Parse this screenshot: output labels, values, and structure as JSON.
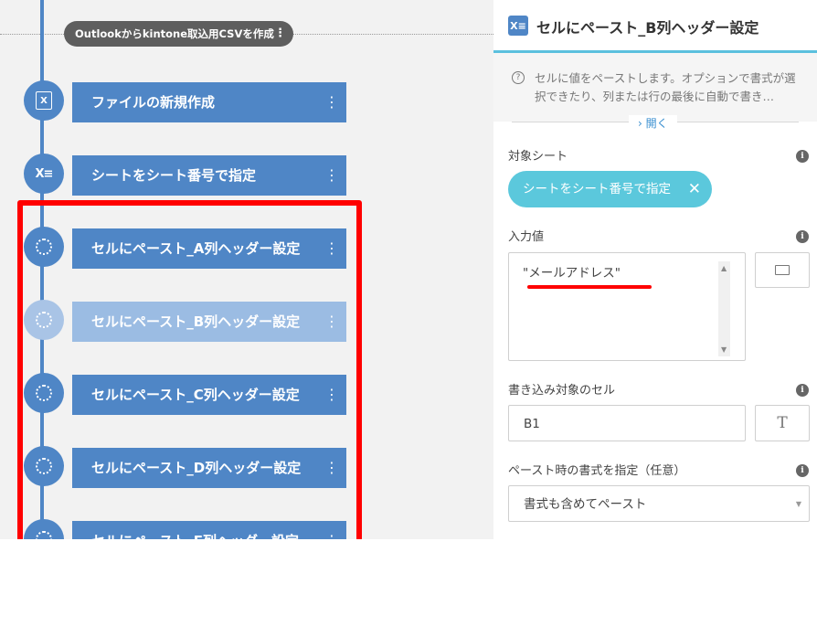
{
  "flow": {
    "group_label": "Outlookからkintone取込用CSVを作成",
    "steps": [
      {
        "label": "ファイルの新規作成",
        "icon": "excel-icon",
        "faded": false
      },
      {
        "label": "シートをシート番号で指定",
        "icon": "excel-sheet-icon",
        "faded": false
      },
      {
        "label": "セルにペースト_A列ヘッダー設定",
        "icon": "loading-circle-icon",
        "faded": false
      },
      {
        "label": "セルにペースト_B列ヘッダー設定",
        "icon": "loading-circle-icon",
        "faded": true
      },
      {
        "label": "セルにペースト_C列ヘッダー設定",
        "icon": "loading-circle-icon",
        "faded": false
      },
      {
        "label": "セルにペースト_D列ヘッダー設定",
        "icon": "loading-circle-icon",
        "faded": false
      },
      {
        "label": "セルにペースト_E列ヘッダー設定",
        "icon": "loading-circle-icon",
        "faded": false
      }
    ],
    "kebab": "⋮"
  },
  "panel": {
    "icon_text": "X≡",
    "title": "セルにペースト_B列ヘッダー設定",
    "description": "セルに値をペーストします。オプションで書式が選択できたり、列または行の最後に自動で書き…",
    "expand_label": "› 開く",
    "target_sheet_label": "対象シート",
    "target_sheet_chip": "シートをシート番号で指定",
    "input_value_label": "入力値",
    "input_value": "\"メールアドレス\"",
    "target_cell_label": "書き込み対象のセル",
    "target_cell_value": "B1",
    "paste_format_label": "ペースト時の書式を指定（任意）",
    "paste_format_value": "書式も含めてペースト"
  },
  "colors": {
    "node_blue": "#4f86c6",
    "chip_cyan": "#5bc8dc",
    "highlight_red": "#ff0000"
  }
}
